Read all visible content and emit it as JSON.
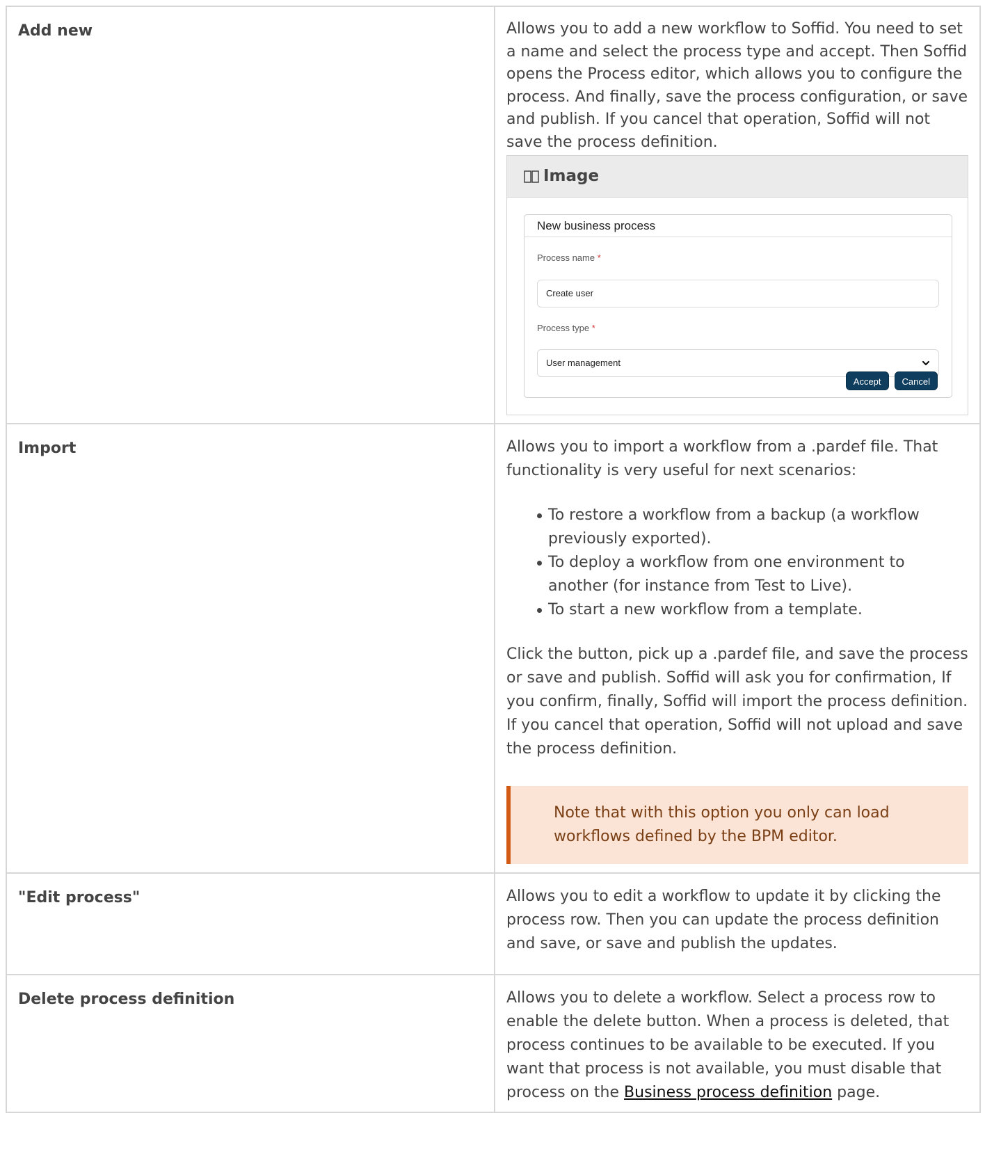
{
  "rows": [
    {
      "action": "Add new",
      "description": "Allows you to add a new workflow to Soffid. You need to set a name and select the process type and accept. Then Soffid opens the Process editor, which allows you to configure the process. And finally, save the process configuration, or save and publish. If you cancel that operation, Soffid will not save the process definition.",
      "image": {
        "heading": "Image",
        "icon": "book-icon",
        "dialog": {
          "title": "New business process",
          "process_name_label": "Process name",
          "process_name_value": "Create user",
          "process_type_label": "Process type",
          "process_type_value": "User management",
          "required_mark": "*",
          "accept_label": "Accept",
          "cancel_label": "Cancel"
        }
      }
    },
    {
      "action": "Import",
      "intro": "Allows you to import a workflow from a .pardef file. That functionality is very useful for next scenarios:",
      "scenarios": [
        "To restore a workflow from a backup (a workflow previously exported).",
        "To deploy a workflow from one environment to another (for instance from Test to Live).",
        "To start a new workflow from a template."
      ],
      "details": "Click the button, pick up a .pardef file, and save the process or save and publish. Soffid will ask you for confirmation, If you confirm, finally,  Soffid will import the process definition. If you cancel that operation, Soffid will not upload and save the process definition.",
      "note": "Note that with this option you only can load workflows defined by the BPM editor."
    },
    {
      "action": "\"Edit process\"",
      "description": "Allows you to edit a workflow to update it by clicking the process row. Then you can update the process definition and save, or save and publish the updates."
    },
    {
      "action": "Delete process definition",
      "description_before_link": "Allows you to delete a workflow. Select a process row to enable the delete button. When a process is deleted, that process continues to be available to be executed. If you want that process is not available, you must disable that process on the",
      "link_text": "Business process definition",
      "description_after_link": "page."
    }
  ],
  "colors": {
    "note_background": "#fbe3d5",
    "note_border": "#d35a14",
    "button": "#0e3d5e"
  }
}
